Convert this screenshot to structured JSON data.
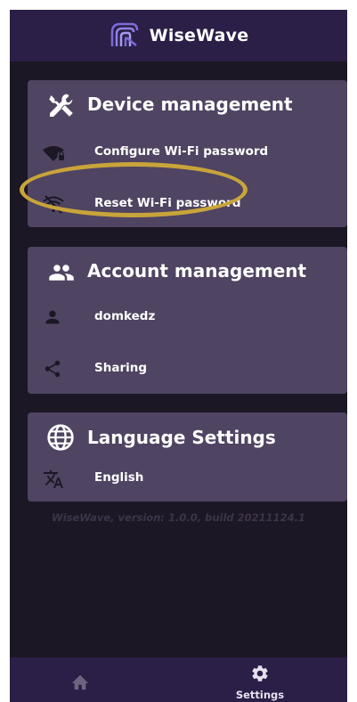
{
  "app": {
    "name": "WiseWave",
    "logo_icon": "wisewave-logo-icon"
  },
  "device_management": {
    "title": "Device management",
    "title_icon": "tools-icon",
    "items": [
      {
        "label": "Configure Wi-Fi password",
        "icon": "wifi-lock-icon"
      },
      {
        "label": "Reset Wi-Fi password",
        "icon": "wifi-off-icon"
      }
    ]
  },
  "account_management": {
    "title": "Account management",
    "title_icon": "people-icon",
    "items": [
      {
        "label": "domkedz",
        "icon": "person-icon"
      },
      {
        "label": "Sharing",
        "icon": "share-icon"
      }
    ]
  },
  "language_settings": {
    "title": "Language Settings",
    "title_icon": "globe-icon",
    "items": [
      {
        "label": "English",
        "icon": "translate-icon"
      }
    ]
  },
  "footer": {
    "version_text": "WiseWave, version: 1.0.0, build 20211124.1"
  },
  "bottom_nav": {
    "items": [
      {
        "label": "",
        "icon": "home-icon"
      },
      {
        "label": "Settings",
        "icon": "gear-icon"
      }
    ]
  },
  "colors": {
    "background": "#1b1724",
    "header": "#2b1f47",
    "card": "#4f4462",
    "annotation": "#c8a43a"
  }
}
